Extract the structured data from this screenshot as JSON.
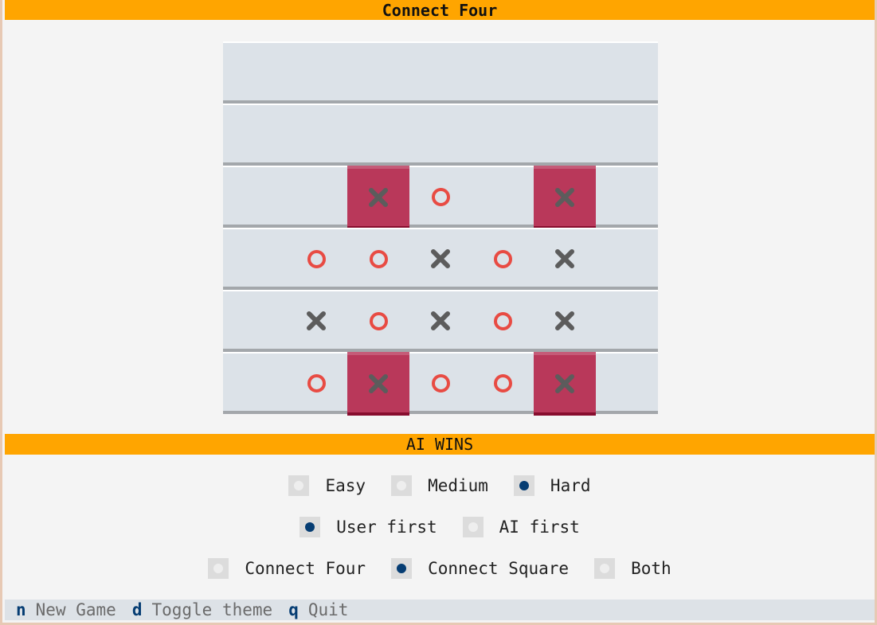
{
  "app": {
    "title": "Connect Four"
  },
  "board": {
    "rows": [
      [
        "",
        "",
        "",
        "",
        "",
        "",
        ""
      ],
      [
        "",
        "",
        "",
        "",
        "",
        "",
        ""
      ],
      [
        "",
        "",
        "X",
        "O",
        "",
        "X",
        ""
      ],
      [
        "",
        "O",
        "O",
        "X",
        "O",
        "X",
        ""
      ],
      [
        "",
        "X",
        "O",
        "X",
        "O",
        "X",
        ""
      ],
      [
        "",
        "O",
        "X",
        "O",
        "O",
        "X",
        ""
      ]
    ],
    "winning_cells": [
      [
        2,
        2
      ],
      [
        2,
        5
      ],
      [
        5,
        2
      ],
      [
        5,
        5
      ]
    ],
    "colors": {
      "o_piece": "#e84b43",
      "x_piece": "#5c5c5c",
      "win_cell": "#b9385a"
    }
  },
  "status": {
    "text": "AI WINS"
  },
  "options": {
    "difficulty": [
      {
        "label": "Easy",
        "selected": false
      },
      {
        "label": "Medium",
        "selected": false
      },
      {
        "label": "Hard",
        "selected": true
      }
    ],
    "first_player": [
      {
        "label": "User first",
        "selected": true
      },
      {
        "label": "AI first",
        "selected": false
      }
    ],
    "mode": [
      {
        "label": "Connect Four",
        "selected": false
      },
      {
        "label": "Connect Square",
        "selected": true
      },
      {
        "label": "Both",
        "selected": false
      }
    ]
  },
  "footer": {
    "keys": [
      {
        "key": "n",
        "label": "New Game"
      },
      {
        "key": "d",
        "label": "Toggle theme"
      },
      {
        "key": "q",
        "label": "Quit"
      }
    ]
  }
}
